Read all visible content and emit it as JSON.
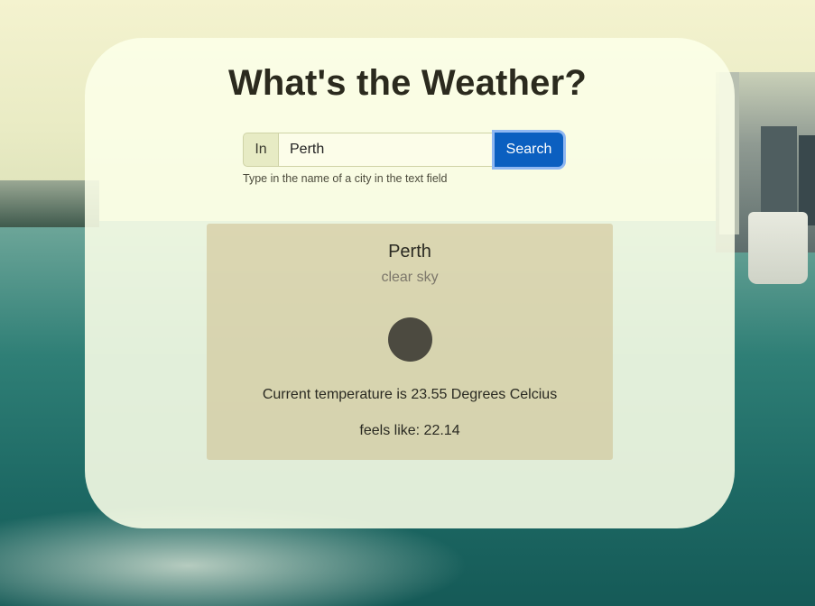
{
  "page": {
    "title": "What's the Weather?"
  },
  "search": {
    "prefix": "In",
    "value": "Perth",
    "button_label": "Search",
    "hint": "Type in the name of a city in the text field"
  },
  "weather": {
    "city": "Perth",
    "description": "clear sky",
    "icon": "weather-icon",
    "temperature_text": "Current temperature is 23.55 Degrees Celcius",
    "feels_like_text": "feels like: 22.14"
  },
  "colors": {
    "button": "#0b5fc0",
    "panel": "#fcffe8",
    "card": "#cdbe8c"
  }
}
